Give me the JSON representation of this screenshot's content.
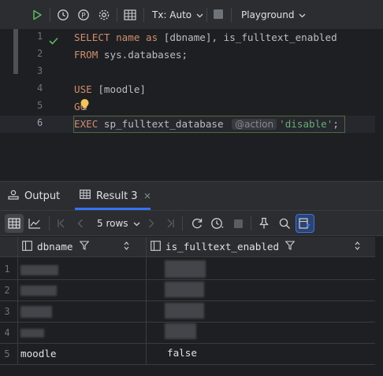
{
  "toolbar": {
    "tx_label": "Tx: Auto",
    "playground_label": "Playground",
    "icons": [
      "run-icon",
      "history-icon",
      "parameters-icon",
      "settings-icon",
      "table-icon",
      "stop-icon"
    ]
  },
  "editor": {
    "line_numbers": [
      "1",
      "2",
      "3",
      "4",
      "5",
      "6"
    ],
    "current_line": "6",
    "line1": {
      "kw1": "SELECT",
      "name_kw": "name",
      "as_kw": "as",
      "rest": " [dbname], is_fulltext_enabled"
    },
    "line2": {
      "kw": "FROM",
      "rest": " sys.databases;"
    },
    "line4": {
      "kw": "USE",
      "rest": " [moodle]"
    },
    "line5": {
      "kw": "GO"
    },
    "line6": {
      "kw": "EXEC",
      "proc": " sp_fulltext_database",
      "hint": "@action",
      "str": "'disable'",
      "tail": ";"
    }
  },
  "panel": {
    "tab_output": "Output",
    "tab_result": "Result 3",
    "rows_label": "5 rows"
  },
  "grid": {
    "columns": [
      "dbname",
      "is_fulltext_enabled"
    ],
    "row_numbers": [
      "1",
      "2",
      "3",
      "4",
      "5"
    ],
    "rows": [
      {
        "dbname": "",
        "is_fulltext_enabled": ""
      },
      {
        "dbname": "",
        "is_fulltext_enabled": ""
      },
      {
        "dbname": "",
        "is_fulltext_enabled": ""
      },
      {
        "dbname": "",
        "is_fulltext_enabled": ""
      },
      {
        "dbname": "moodle",
        "is_fulltext_enabled": "false"
      }
    ]
  },
  "colors": {
    "keyword": "#cf8e6d",
    "string": "#6aab73",
    "run_green": "#5fb865",
    "accent_blue": "#3574f0",
    "bulb_yellow": "#f2c55c"
  }
}
